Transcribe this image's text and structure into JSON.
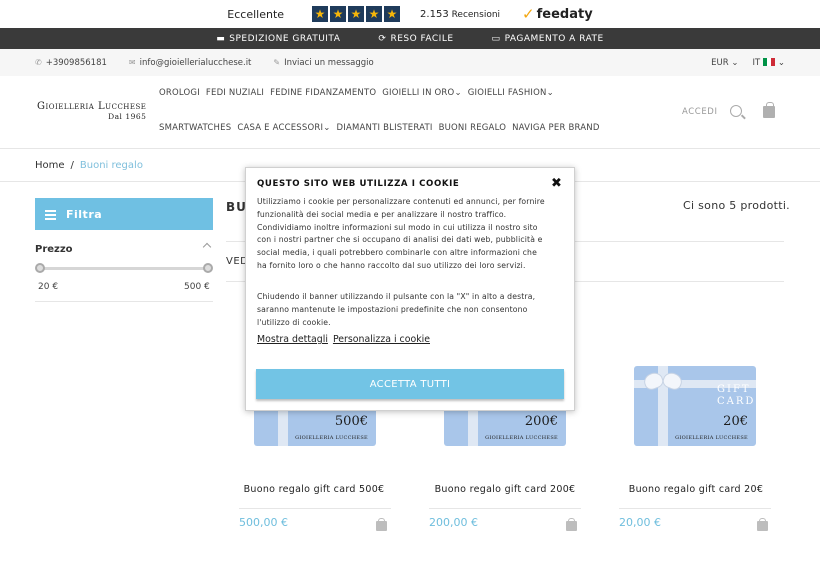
{
  "review": {
    "label": "Eccellente",
    "stars": [
      "★",
      "★",
      "★",
      "★",
      "★"
    ],
    "count": "2.153",
    "count_suffix": "Recensioni",
    "brand": "feedaty"
  },
  "promo": {
    "items": [
      {
        "icon": "truck-icon",
        "label": "SPEDIZIONE GRATUITA"
      },
      {
        "icon": "refresh-icon",
        "label": "RESO FACILE"
      },
      {
        "icon": "credit-card-icon",
        "label": "PAGAMENTO A RATE"
      }
    ]
  },
  "contacts": {
    "phone": "+3909856181",
    "email": "info@gioiellerialucchese.it",
    "message": "Inviaci un messaggio",
    "currency": "EUR",
    "language": "IT"
  },
  "header": {
    "logo_name": "Gioielleria Lucchese",
    "logo_since": "Dal 1965",
    "nav_row1": [
      "OROLOGI",
      "FEDI NUZIALI",
      "FEDINE FIDANZAMENTO",
      "GIOIELLI IN ORO",
      "GIOIELLI FASHION"
    ],
    "nav_row2": [
      "SMARTWATCHES",
      "CASA E ACCESSORI",
      "DIAMANTI BLISTERATI",
      "BUONI REGALO",
      "NAVIGA PER BRAND"
    ],
    "accedi": "ACCEDI"
  },
  "breadcrumb": {
    "home": "Home",
    "separator": "/",
    "current": "Buoni regalo"
  },
  "sidebar": {
    "filter_label": "Filtra",
    "price_label": "Prezzo",
    "price_min": "20 €",
    "price_max": "500 €"
  },
  "main": {
    "title_partial": "BU",
    "product_count": "Ci sono 5 prodotti.",
    "vedi_partial": "VED"
  },
  "products": [
    {
      "name": "Buono regalo gift card 500€",
      "price": "500,00 €",
      "amount": "500€"
    },
    {
      "name": "Buono regalo gift card 200€",
      "price": "200,00 €",
      "amount": "200€"
    },
    {
      "name": "Buono regalo gift card 20€",
      "price": "20,00 €",
      "amount": "20€"
    }
  ],
  "card_brand": "GIOIELLERIA LUCCHESE",
  "card_gift_text": "GIFT CARD",
  "cookie": {
    "title": "QUESTO SITO WEB UTILIZZA I COOKIE",
    "close": "✖",
    "paragraph1": "Utilizziamo i cookie per personalizzare contenuti ed annunci, per fornire funzionalità dei social media e per analizzare il nostro traffico. Condividiamo inoltre informazioni sul modo in cui utilizza il nostro sito con i nostri partner che si occupano di analisi dei dati web, pubblicità e social media, i quali potrebbero combinarle con altre informazioni che ha fornito loro o che hanno raccolto dal suo utilizzo dei loro servizi.",
    "paragraph2": "Chiudendo il banner utilizzando il pulsante con la \"X\" in alto a destra, saranno mantenute le impostazioni predefinite che non consentono l'utilizzo di cookie.",
    "show_details": "Mostra dettagli",
    "customize": "Personalizza i cookie",
    "accept_all": "ACCETTA TUTTI"
  }
}
